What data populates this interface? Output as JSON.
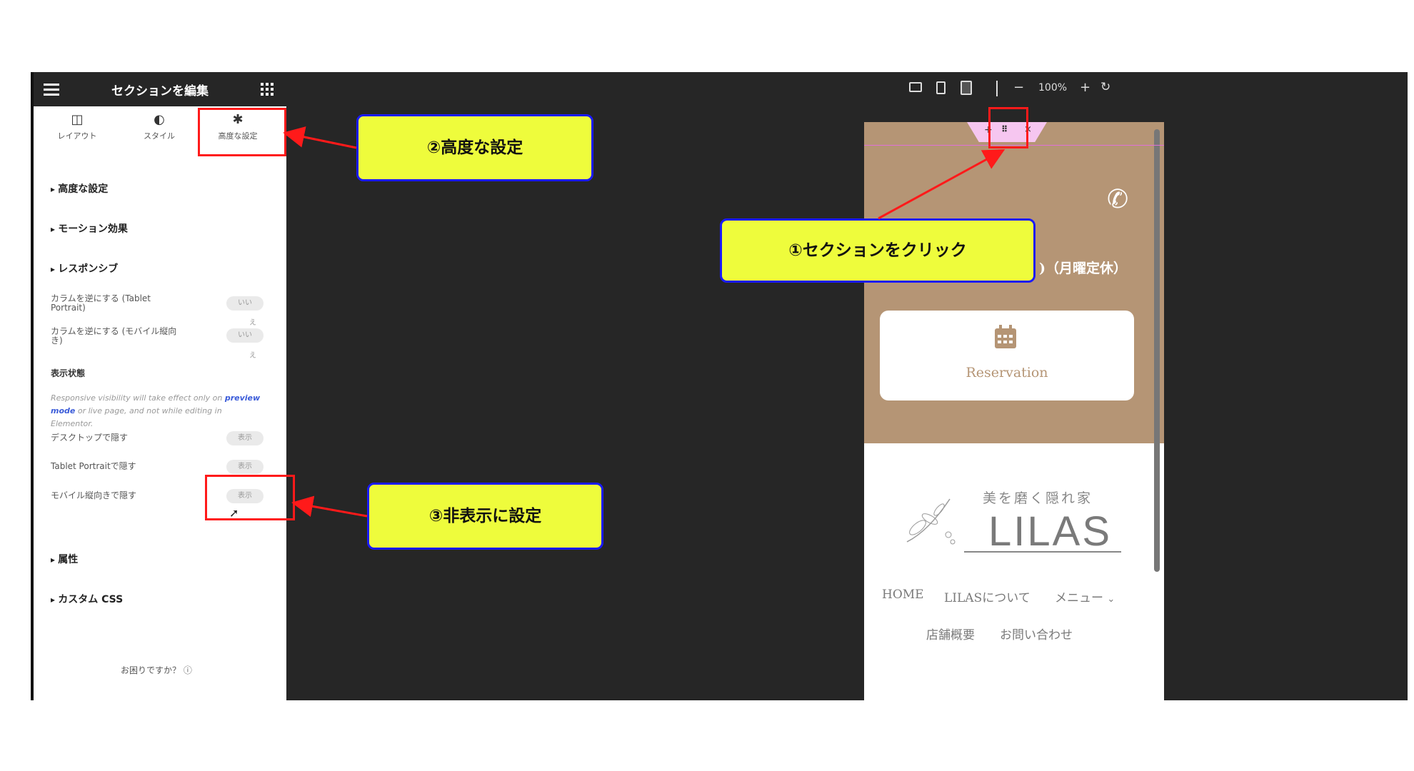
{
  "panel": {
    "title": "セクションを編集",
    "tabs": [
      {
        "label": "レイアウト",
        "icon": "columns-icon"
      },
      {
        "label": "スタイル",
        "icon": "contrast-icon"
      },
      {
        "label": "高度な設定",
        "icon": "gear-icon"
      }
    ],
    "sections": {
      "advanced": "高度な設定",
      "motion": "モーション効果",
      "responsive": "レスポンシブ",
      "attributes": "属性",
      "custom_css": "カスタム CSS"
    },
    "reverse_tablet": {
      "label": "カラムを逆にする (Tablet Portrait)",
      "toggle": "いい",
      "toggle_suffix": "え"
    },
    "reverse_mobile": {
      "label": "カラムを逆にする (モバイル縦向き)",
      "toggle": "いい",
      "toggle_suffix": "え"
    },
    "visibility_heading": "表示状態",
    "visibility_note_1": "Responsive visibility will take effect only on",
    "visibility_note_link": "preview mode",
    "visibility_note_2": "or live page, and not while editing in Elementor.",
    "hide_desktop": {
      "label": "デスクトップで隠す",
      "toggle": "表示"
    },
    "hide_tablet": {
      "label": "Tablet Portraitで隠す",
      "toggle": "表示"
    },
    "hide_mobile": {
      "label": "モバイル縦向きで隠す",
      "toggle": "表示"
    },
    "help": "お困りですか？"
  },
  "toolbar": {
    "zoom": "100%",
    "minus": "−",
    "plus": "+"
  },
  "preview": {
    "hours_suffix": ")（月曜定休）",
    "reservation": "Reservation",
    "logo_sub": "美を磨く隠れ家",
    "logo_main": "LILAS",
    "nav": [
      "HOME",
      "LILASについて",
      "メニュー",
      "店舗概要",
      "お問い合わせ"
    ]
  },
  "callouts": {
    "one": "①セクションをクリック",
    "two": "②高度な設定",
    "three": "③非表示に設定"
  },
  "colors": {
    "editor_dark": "#262626",
    "hero_brown": "#b59575",
    "callout_fill": "#eefc3c",
    "callout_border": "#1a1aff",
    "highlight_red": "#ff1a1a"
  }
}
